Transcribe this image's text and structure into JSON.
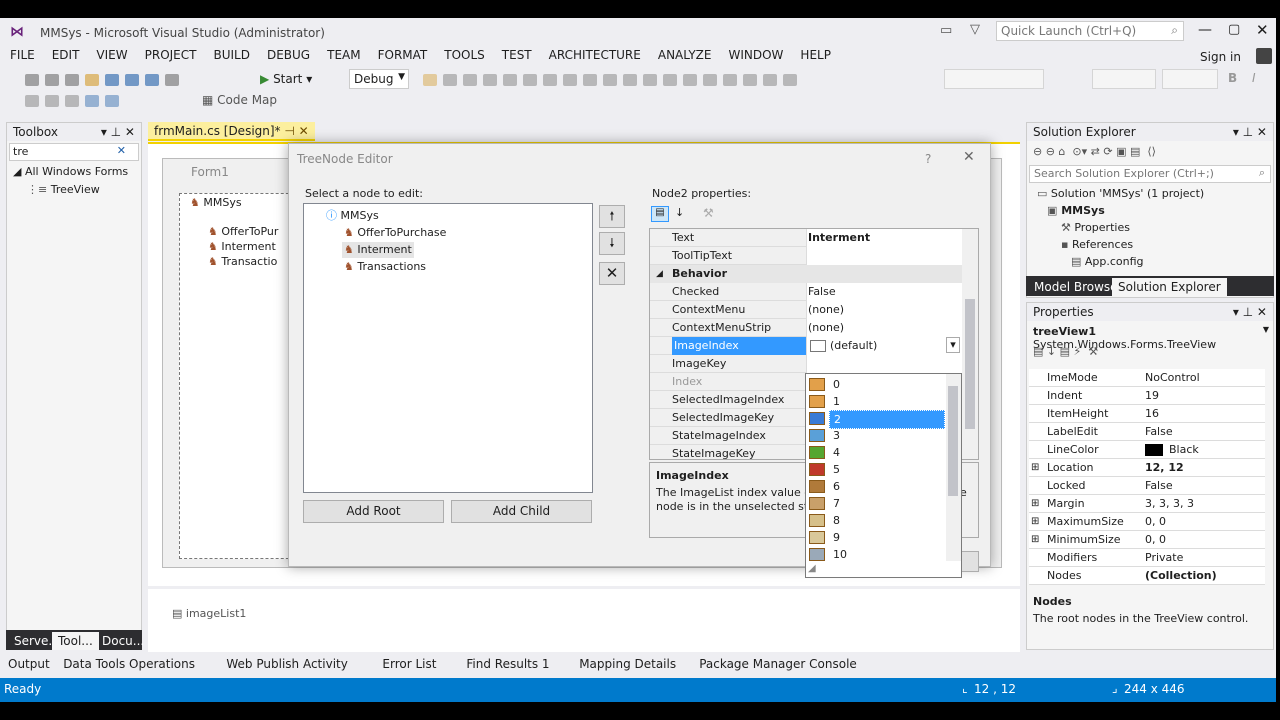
{
  "window": {
    "title": "MMSys - Microsoft Visual Studio (Administrator)",
    "quick_launch": "Quick Launch (Ctrl+Q)",
    "sign_in": "Sign in"
  },
  "menu": [
    "FILE",
    "EDIT",
    "VIEW",
    "PROJECT",
    "BUILD",
    "DEBUG",
    "TEAM",
    "FORMAT",
    "TOOLS",
    "TEST",
    "ARCHITECTURE",
    "ANALYZE",
    "WINDOW",
    "HELP"
  ],
  "toolbar": {
    "start": "Start",
    "config": "Debug",
    "code_map": "Code Map"
  },
  "toolbox": {
    "title": "Toolbox",
    "search": "tre",
    "group": "All Windows Forms",
    "item": "TreeView",
    "tabs": [
      "Serve...",
      "Tool...",
      "Docu..."
    ]
  },
  "doc_tab": "frmMain.cs [Design]*",
  "designer": {
    "form_title": "Form1",
    "nodes": [
      "MMSys",
      "OfferToPur",
      "Interment",
      "Transactio"
    ],
    "component": "imageList1"
  },
  "dialog": {
    "title": "TreeNode Editor",
    "help": "?",
    "select_label": "Select a node to edit:",
    "tree": [
      "MMSys",
      "OfferToPurchase",
      "Interment",
      "Transactions"
    ],
    "add_root": "Add Root",
    "add_child": "Add Child",
    "props_label": "Node2 properties:",
    "rows": [
      {
        "n": "Text",
        "v": "Interment"
      },
      {
        "n": "ToolTipText",
        "v": ""
      }
    ],
    "category": "Behavior",
    "rows2": [
      {
        "n": "Checked",
        "v": "False"
      },
      {
        "n": "ContextMenu",
        "v": "(none)"
      },
      {
        "n": "ContextMenuStrip",
        "v": "(none)"
      },
      {
        "n": "ImageIndex",
        "v": "(default)"
      },
      {
        "n": "ImageKey",
        "v": ""
      },
      {
        "n": "Index",
        "v": ""
      },
      {
        "n": "SelectedImageIndex",
        "v": ""
      },
      {
        "n": "SelectedImageKey",
        "v": ""
      },
      {
        "n": "StateImageIndex",
        "v": ""
      },
      {
        "n": "StateImageKey",
        "v": ""
      }
    ],
    "desc_title": "ImageIndex",
    "desc_text": "The ImageList index value of th                                   e node is in the unselected state",
    "desc_line1": "The ImageList index value of th",
    "desc_line1b": "e",
    "desc_line2": "node is in the unselected state",
    "dropdown": [
      "0",
      "1",
      "2",
      "3",
      "4",
      "5",
      "6",
      "7",
      "8",
      "9",
      "10"
    ],
    "dropdown_selected": "2"
  },
  "solution": {
    "title": "Solution Explorer",
    "search": "Search Solution Explorer (Ctrl+;)",
    "items": [
      "Solution 'MMSys' (1 project)",
      "MMSys",
      "Properties",
      "References",
      "App.config"
    ],
    "tabs": [
      "Model Browser",
      "Solution Explorer"
    ]
  },
  "properties": {
    "title": "Properties",
    "object": "treeView1",
    "type": "System.Windows.Forms.TreeView",
    "rows": [
      {
        "n": "ImeMode",
        "v": "NoControl"
      },
      {
        "n": "Indent",
        "v": "19"
      },
      {
        "n": "ItemHeight",
        "v": "16"
      },
      {
        "n": "LabelEdit",
        "v": "False"
      },
      {
        "n": "LineColor",
        "v": "Black"
      },
      {
        "n": "Location",
        "v": "12, 12"
      },
      {
        "n": "Locked",
        "v": "False"
      },
      {
        "n": "Margin",
        "v": "3, 3, 3, 3"
      },
      {
        "n": "MaximumSize",
        "v": "0, 0"
      },
      {
        "n": "MinimumSize",
        "v": "0, 0"
      },
      {
        "n": "Modifiers",
        "v": "Private"
      },
      {
        "n": "Nodes",
        "v": "(Collection)"
      }
    ],
    "desc_title": "Nodes",
    "desc_text": "The root nodes in the TreeView control."
  },
  "bottom_tabs": [
    "Output",
    "Data Tools Operations",
    "Web Publish Activity",
    "Error List",
    "Find Results 1",
    "Mapping Details",
    "Package Manager Console"
  ],
  "status": {
    "text": "Ready",
    "pos": "12 , 12",
    "size": "244 x 446"
  },
  "colors": {
    "accent": "#007acc",
    "selection": "#3399ff"
  }
}
